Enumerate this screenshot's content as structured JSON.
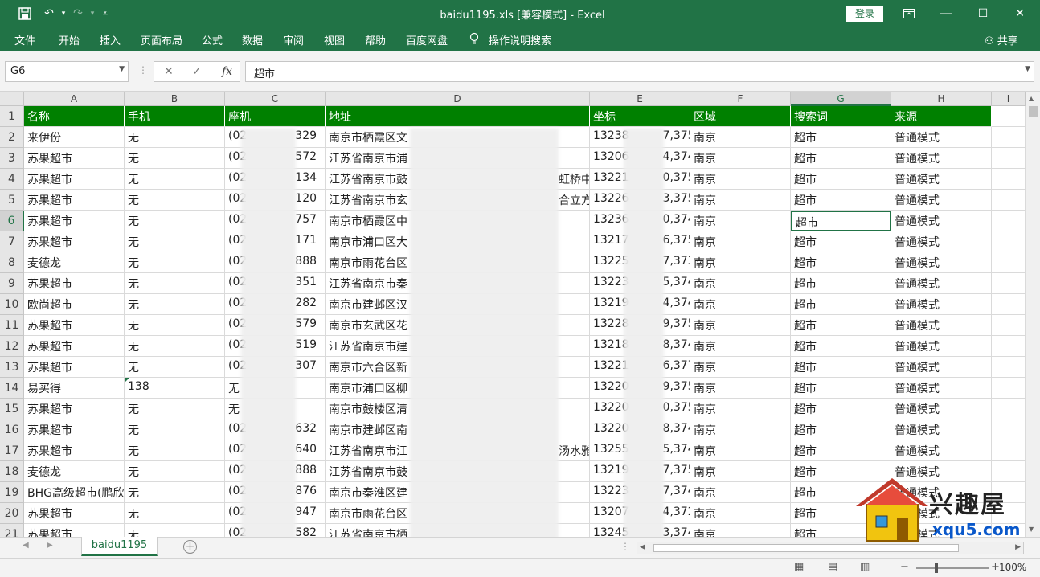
{
  "window": {
    "title": "baidu1195.xls  [兼容模式]  -  Excel",
    "login_label": "登录",
    "share_label": "共享"
  },
  "ribbon_tabs": [
    "文件",
    "开始",
    "插入",
    "页面布局",
    "公式",
    "数据",
    "审阅",
    "视图",
    "帮助",
    "百度网盘",
    "操作说明搜索"
  ],
  "formula_bar": {
    "name_box": "G6",
    "value": "超市"
  },
  "columns": [
    "A",
    "B",
    "C",
    "D",
    "E",
    "F",
    "G",
    "H",
    "I"
  ],
  "selected_column": "G",
  "selected_row": 6,
  "header_row": [
    "名称",
    "手机",
    "座机",
    "地址",
    "坐标",
    "区域",
    "搜索词",
    "来源"
  ],
  "rows": [
    {
      "n": "2",
      "a": "来伊份",
      "b": "无",
      "c1": "(02",
      "c2": "329",
      "d": "南京市栖霞区文",
      "e1": "13238",
      "e2": "7,375",
      "f": "南京",
      "g": "超市",
      "h": "普通模式"
    },
    {
      "n": "3",
      "a": "苏果超市",
      "b": "无",
      "c1": "(02",
      "c2": "572",
      "d": "江苏省南京市浦",
      "e1": "13206",
      "e2": "4,374",
      "f": "南京",
      "g": "超市",
      "h": "普通模式"
    },
    {
      "n": "4",
      "a": "苏果超市",
      "b": "无",
      "c1": "(02",
      "c2": "134",
      "d": "江苏省南京市鼓",
      "d2": "虹桥中",
      "e1": "13221",
      "e2": "0,375",
      "f": "南京",
      "g": "超市",
      "h": "普通模式"
    },
    {
      "n": "5",
      "a": "苏果超市",
      "b": "无",
      "c1": "(02",
      "c2": "120",
      "d": "江苏省南京市玄",
      "d2": "合立方",
      "e1": "13226",
      "e2": "3,375",
      "f": "南京",
      "g": "超市",
      "h": "普通模式"
    },
    {
      "n": "6",
      "a": "苏果超市",
      "b": "无",
      "c1": "(02",
      "c2": "757",
      "d": "南京市栖霞区中",
      "e1": "13236",
      "e2": "0,374",
      "f": "南京",
      "g": "超市",
      "h": "普通模式"
    },
    {
      "n": "7",
      "a": "苏果超市",
      "b": "无",
      "c1": "(02",
      "c2": "171",
      "d": "南京市浦口区大",
      "e1": "13217",
      "e2": "6,375",
      "f": "南京",
      "g": "超市",
      "h": "普通模式"
    },
    {
      "n": "8",
      "a": "麦德龙",
      "b": "无",
      "c1": "(02",
      "c2": "888",
      "d": "南京市雨花台区",
      "e1": "13225",
      "e2": "7,373",
      "f": "南京",
      "g": "超市",
      "h": "普通模式"
    },
    {
      "n": "9",
      "a": "苏果超市",
      "b": "无",
      "c1": "(02",
      "c2": "351",
      "d": "江苏省南京市秦",
      "e1": "13223",
      "e2": "5,374",
      "f": "南京",
      "g": "超市",
      "h": "普通模式"
    },
    {
      "n": "10",
      "a": "欧尚超市",
      "b": "无",
      "c1": "(02",
      "c2": "282",
      "d": "南京市建邺区汉",
      "e1": "13219",
      "e2": "4,374",
      "f": "南京",
      "g": "超市",
      "h": "普通模式"
    },
    {
      "n": "11",
      "a": "苏果超市",
      "b": "无",
      "c1": "(02",
      "c2": "579",
      "d": "南京市玄武区花",
      "e1": "13228",
      "e2": "9,375",
      "f": "南京",
      "g": "超市",
      "h": "普通模式"
    },
    {
      "n": "12",
      "a": "苏果超市",
      "b": "无",
      "c1": "(02",
      "c2": "519",
      "d": "江苏省南京市建",
      "e1": "13218",
      "e2": "8,374",
      "f": "南京",
      "g": "超市",
      "h": "普通模式"
    },
    {
      "n": "13",
      "a": "苏果超市",
      "b": "无",
      "c1": "(02",
      "c2": "307",
      "d": "南京市六合区新",
      "e1": "13221",
      "e2": "6,377",
      "f": "南京",
      "g": "超市",
      "h": "普通模式"
    },
    {
      "n": "14",
      "a": "易买得",
      "b": "138",
      "c1": "无",
      "c2": "",
      "d": "南京市浦口区柳",
      "e1": "13220",
      "e2": "9,375",
      "f": "南京",
      "g": "超市",
      "h": "普通模式",
      "marker": true
    },
    {
      "n": "15",
      "a": "苏果超市",
      "b": "无",
      "c1": "无",
      "c2": "",
      "d": "南京市鼓楼区清",
      "e1": "13220",
      "e2": "0,375",
      "f": "南京",
      "g": "超市",
      "h": "普通模式"
    },
    {
      "n": "16",
      "a": "苏果超市",
      "b": "无",
      "c1": "(02",
      "c2": "632",
      "d": "南京市建邺区南",
      "e1": "13220",
      "e2": "8,374",
      "f": "南京",
      "g": "超市",
      "h": "普通模式"
    },
    {
      "n": "17",
      "a": "苏果超市",
      "b": "无",
      "c1": "(02",
      "c2": "640",
      "d": "江苏省南京市江",
      "d2": "汤水雅",
      "e1": "13255",
      "e2": "5,374",
      "f": "南京",
      "g": "超市",
      "h": "普通模式"
    },
    {
      "n": "18",
      "a": "麦德龙",
      "b": "无",
      "c1": "(02",
      "c2": "888",
      "d": "江苏省南京市鼓",
      "e1": "13219",
      "e2": "7,375",
      "f": "南京",
      "g": "超市",
      "h": "普通模式"
    },
    {
      "n": "19",
      "a": "BHG高级超市(鹏欣",
      "b": "无",
      "c1": "(02",
      "c2": "876",
      "d": "南京市秦淮区建",
      "e1": "13223",
      "e2": "7,374",
      "f": "南京",
      "g": "超市",
      "h": "普通模式"
    },
    {
      "n": "20",
      "a": "苏果超市",
      "b": "无",
      "c1": "(02",
      "c2": "947",
      "d": "南京市雨花台区",
      "e1": "13207",
      "e2": "4,372",
      "f": "南京",
      "g": "超市",
      "h": "普通模式"
    },
    {
      "n": "21",
      "a": "苏果超市",
      "b": "无",
      "c1": "(02",
      "c2": "582",
      "d": "江苏省南京市栖",
      "e1": "13245",
      "e2": "3,374",
      "f": "南京",
      "g": "超市",
      "h": "普通模式"
    }
  ],
  "sheet_tab": "baidu1195",
  "status": {
    "zoom": "100%"
  },
  "watermark": {
    "text": "兴趣屋",
    "url": "xqu5.com"
  }
}
